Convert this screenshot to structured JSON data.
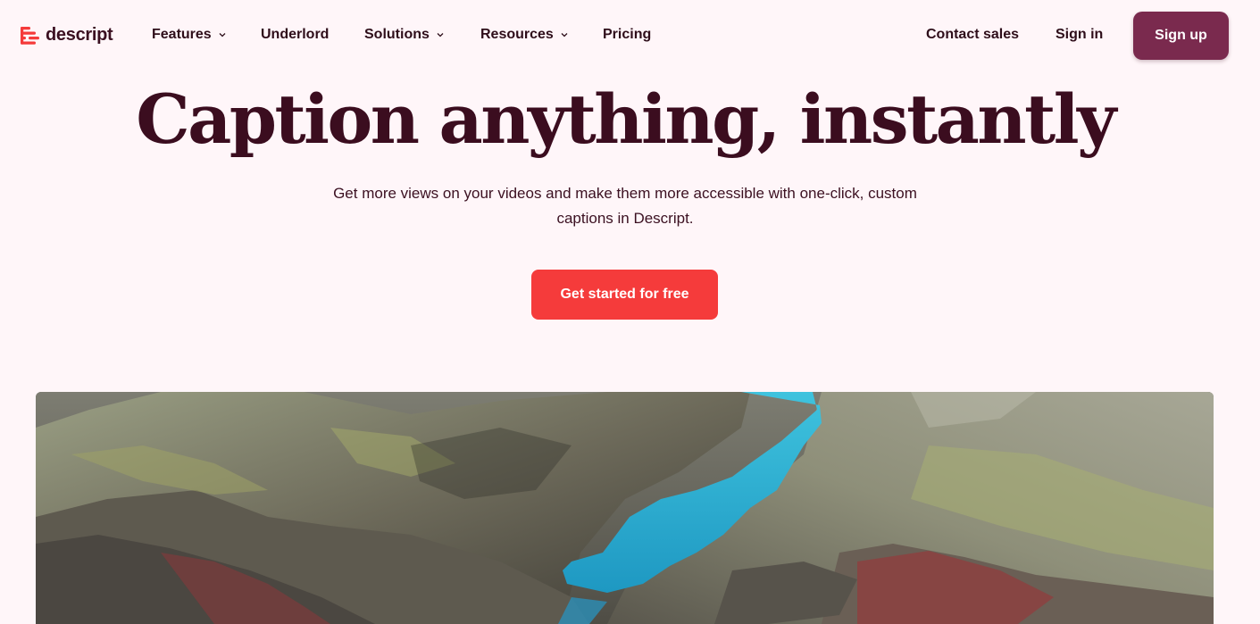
{
  "brand": {
    "name": "descript",
    "accent": "#f53b3b",
    "primary": "#7a2a4e",
    "background": "#fff6f9",
    "text": "#3b0d1f"
  },
  "nav": {
    "items": [
      {
        "label": "Features",
        "dropdown": true
      },
      {
        "label": "Underlord",
        "dropdown": false
      },
      {
        "label": "Solutions",
        "dropdown": true
      },
      {
        "label": "Resources",
        "dropdown": true
      },
      {
        "label": "Pricing",
        "dropdown": false
      }
    ],
    "contact_sales": "Contact sales",
    "sign_in": "Sign in",
    "sign_up": "Sign up"
  },
  "hero": {
    "title": "Caption anything, instantly",
    "subtitle_line1": "Get more views on your videos and make them more accessible with one-click, custom",
    "subtitle_line2": "captions in Descript.",
    "cta": "Get started for free"
  },
  "media": {
    "icon": "aerial-landscape-image"
  }
}
